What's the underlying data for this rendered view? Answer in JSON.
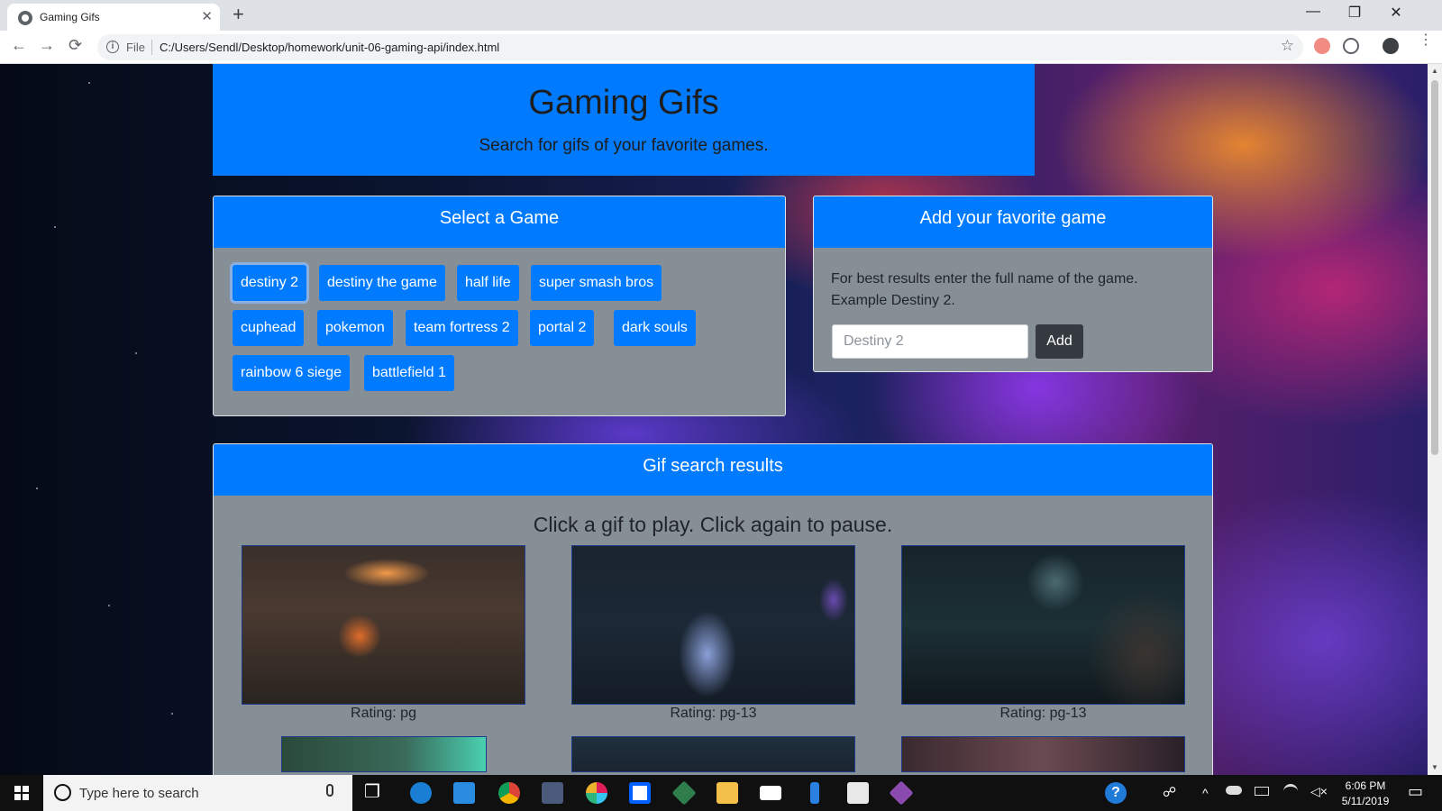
{
  "browser": {
    "tab_title": "Gaming Gifs",
    "tab_close": "✕",
    "new_tab": "+",
    "window_controls": {
      "minimize": "—",
      "restore": "❐",
      "close": "✕"
    },
    "nav": {
      "back": "←",
      "forward": "→",
      "reload": "⟳"
    },
    "info_symbol": "i",
    "file_label": "File",
    "url": "C:/Users/Sendl/Desktop/homework/unit-06-gaming-api/index.html",
    "star_icon": "☆",
    "menu_dots": "⋮",
    "icons": [
      "back-icon",
      "forward-icon",
      "reload-icon",
      "info-icon",
      "bookmark-star-icon",
      "extension-icon",
      "profile-avatar-icon",
      "menu-icon"
    ]
  },
  "header": {
    "title": "Gaming Gifs",
    "subtitle": "Search for gifs of your favorite games."
  },
  "select_game": {
    "title": "Select a Game",
    "buttons": [
      "destiny 2",
      "destiny the game",
      "half life",
      "super smash bros",
      "cuphead",
      "pokemon",
      "team fortress 2",
      "portal 2",
      "dark souls",
      "rainbow 6 siege",
      "battlefield 1"
    ],
    "active": "destiny 2"
  },
  "add_game": {
    "title": "Add your favorite game",
    "hint": "For best results enter the full name of the game. Example Destiny 2.",
    "input_placeholder": "Destiny 2",
    "input_value": "",
    "add_label": "Add"
  },
  "results": {
    "title": "Gif search results",
    "instructions": "Click a gif to play. Click again to pause.",
    "gifs": [
      {
        "rating": "Rating: pg"
      },
      {
        "rating": "Rating: pg-13"
      },
      {
        "rating": "Rating: pg-13"
      }
    ]
  },
  "taskbar": {
    "search_placeholder": "Type here to search",
    "apps": [
      "task-view-icon",
      "edge-icon",
      "vscode-icon",
      "chrome-icon",
      "git-bash-icon",
      "slack-icon",
      "dropbox-icon",
      "gitkraken-icon",
      "file-explorer-icon",
      "mail-icon",
      "visual-studio-icon",
      "store-icon",
      "gitkraken-icon"
    ],
    "help_glyph": "?",
    "people_glyph": "☍",
    "tray_chevron": "^",
    "time": "6:06 PM",
    "date": "5/11/2019",
    "notification_glyph": "▭"
  },
  "colors": {
    "primary": "#007bff",
    "card_body": "#868e96",
    "dark_button": "#343a40",
    "taskbar": "#101010"
  }
}
